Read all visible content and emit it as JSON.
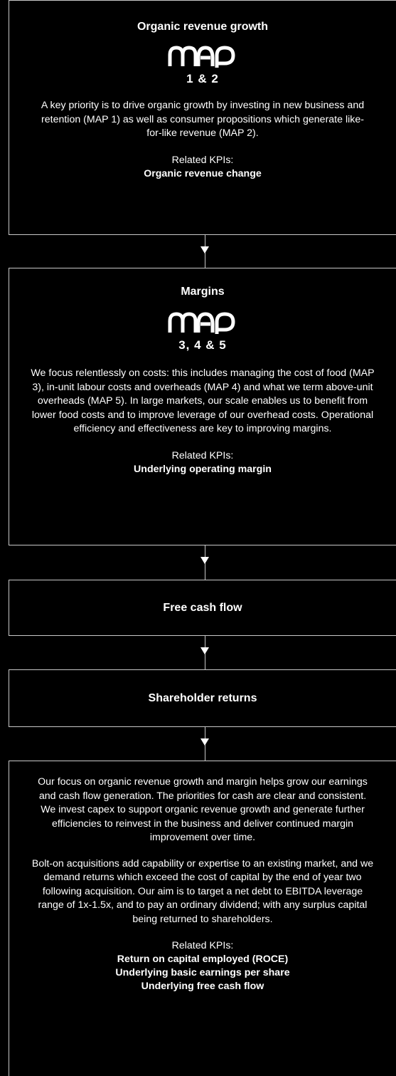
{
  "box1": {
    "title": "Organic revenue growth",
    "logo": "MAP",
    "numbers": "1 & 2",
    "text": "A key priority is to drive organic growth by investing in new business and retention (MAP 1) as well as consumer propositions which generate like-for-like revenue (MAP 2).",
    "kpi_label": "Related KPIs:",
    "kpis": [
      "Organic revenue change"
    ]
  },
  "box2": {
    "title": "Margins",
    "logo": "MAP",
    "numbers": "3, 4 & 5",
    "text": "We focus relentlessly on costs: this includes managing the cost of food (MAP 3), in-unit labour costs and overheads (MAP 4) and what we term above-unit overheads (MAP 5). In large markets, our scale enables us to benefit from lower food costs and to improve leverage of our overhead costs. Operational efficiency and effectiveness are key to improving margins.",
    "kpi_label": "Related KPIs:",
    "kpis": [
      "Underlying operating margin"
    ]
  },
  "box3": {
    "title": "Free cash flow"
  },
  "box4": {
    "title": "Shareholder returns"
  },
  "box5": {
    "text1": "Our focus on organic revenue growth and margin helps grow our earnings and cash flow generation. The priorities for cash are clear and consistent. We invest capex to support organic revenue growth and generate further efficiencies to reinvest in the business and deliver continued margin improvement over time.",
    "text2": "Bolt-on acquisitions add capability or expertise to an existing market, and we demand returns which exceed the cost of capital by the end of year two following acquisition. Our aim is to target a net debt to EBITDA leverage range of 1x-1.5x, and to pay an ordinary dividend; with any surplus capital being returned to shareholders.",
    "kpi_label": "Related KPIs:",
    "kpis": [
      "Return on capital employed (ROCE)",
      "Underlying basic earnings per share",
      "Underlying free cash flow"
    ]
  },
  "colors": {
    "background": "#000000",
    "border": "#c8c8c8",
    "text": "#ffffff"
  },
  "icons": {
    "map_logo": "map-logo-icon",
    "arrow": "arrow-down-icon"
  }
}
